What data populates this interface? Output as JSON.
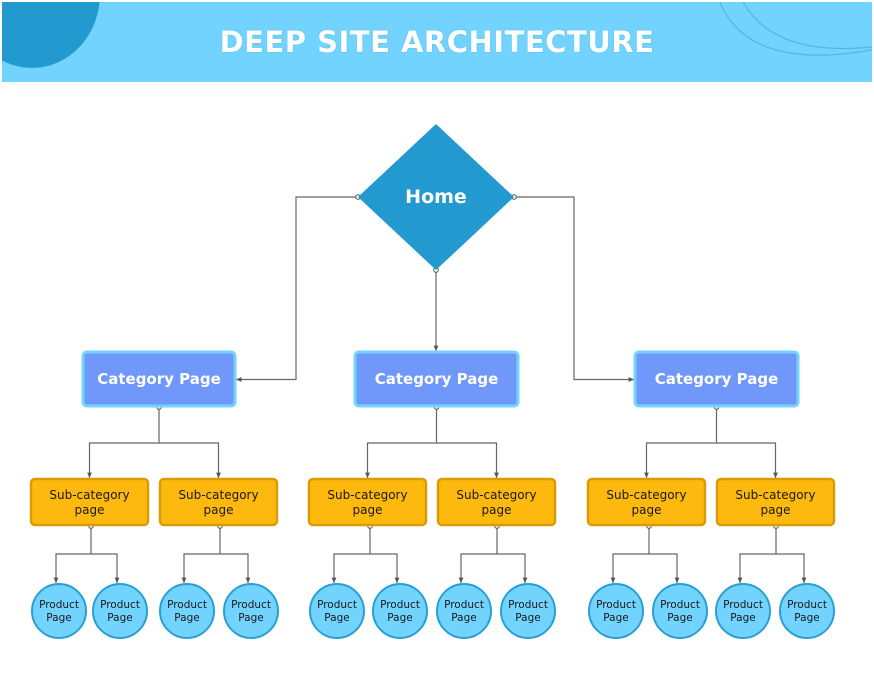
{
  "header": {
    "title": "DEEP SITE ARCHITECTURE"
  },
  "colors": {
    "header_bg": "#72D3FE",
    "header_accent": "#229AD0",
    "header_arc": "#4FB8E0",
    "home_fill": "#229AD0",
    "category_fill": "#7098FB",
    "category_border": "#72D3FE",
    "subcategory_fill": "#FDB90D",
    "subcategory_border": "#D99B07",
    "product_fill": "#72D3FE",
    "product_border": "#2A9FD3",
    "connector": "#666666"
  },
  "diagram": {
    "home": {
      "label": "Home"
    },
    "categories": [
      {
        "label": "Category Page",
        "subcategories": [
          {
            "label_line1": "Sub-category",
            "label_line2": "page",
            "products": [
              {
                "line1": "Product",
                "line2": "Page"
              },
              {
                "line1": "Product",
                "line2": "Page"
              }
            ]
          },
          {
            "label_line1": "Sub-category",
            "label_line2": "page",
            "products": [
              {
                "line1": "Product",
                "line2": "Page"
              },
              {
                "line1": "Product",
                "line2": "Page"
              }
            ]
          }
        ]
      },
      {
        "label": "Category Page",
        "subcategories": [
          {
            "label_line1": "Sub-category",
            "label_line2": "page",
            "products": [
              {
                "line1": "Product",
                "line2": "Page"
              },
              {
                "line1": "Product",
                "line2": "Page"
              }
            ]
          },
          {
            "label_line1": "Sub-category",
            "label_line2": "page",
            "products": [
              {
                "line1": "Product",
                "line2": "Page"
              },
              {
                "line1": "Product",
                "line2": "Page"
              }
            ]
          }
        ]
      },
      {
        "label": "Category Page",
        "subcategories": [
          {
            "label_line1": "Sub-category",
            "label_line2": "page",
            "products": [
              {
                "line1": "Product",
                "line2": "Page"
              },
              {
                "line1": "Product",
                "line2": "Page"
              }
            ]
          },
          {
            "label_line1": "Sub-category",
            "label_line2": "page",
            "products": [
              {
                "line1": "Product",
                "line2": "Page"
              },
              {
                "line1": "Product",
                "line2": "Page"
              }
            ]
          }
        ]
      }
    ]
  }
}
